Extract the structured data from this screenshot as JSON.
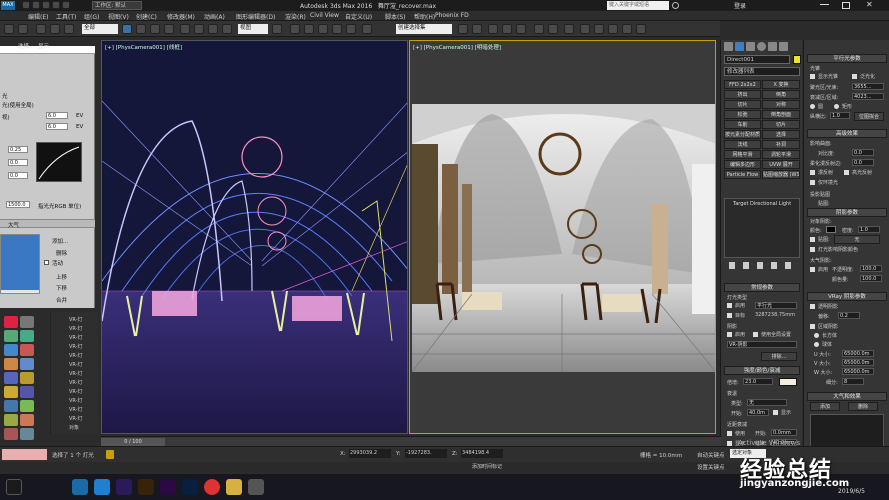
{
  "window": {
    "title": "Autodesk 3ds Max 2016",
    "file": "舞厅渲_recover.max",
    "workspace_label": "工作区: 默认",
    "search_placeholder": "键入关键字或短语",
    "login": "登录"
  },
  "menu": [
    "编辑(E)",
    "工具(T)",
    "组(G)",
    "视图(V)",
    "创建(C)",
    "修改器(M)",
    "动画(A)",
    "图形编辑器(D)",
    "渲染(R)",
    "Civil View",
    "自定义(U)",
    "脚本(S)",
    "帮助(H)",
    "Phoenix FD"
  ],
  "toolbar": {
    "selection_filter": "全部",
    "view_dropdown": "视图",
    "named_selection": "创建选择集"
  },
  "left_panel": {
    "tabs": [
      "选择",
      "显示"
    ],
    "rows": [
      "光",
      "光(使用全局)",
      "视)",
      "EV",
      "EV",
      "指光光RGB 单位)"
    ],
    "values": [
      "6.0",
      "6.0",
      "0.25",
      "0.0",
      "0.0",
      "1500.0"
    ],
    "section_atmos": "大气",
    "btn_add": "添加...",
    "btn_delete": "删除",
    "btn_active": "活动",
    "btn_up": "上移",
    "btn_down": "下移",
    "btn_merge": "合并"
  },
  "scene_list": {
    "items": [
      "VR-灯",
      "VR-灯",
      "VR-灯",
      "VR-灯",
      "VR-灯",
      "VR-灯",
      "VR-灯",
      "VR-灯",
      "VR-灯",
      "VR-灯",
      "VR-灯",
      "VR-灯",
      "对象"
    ]
  },
  "viewports": {
    "left_label": "[+] [PhysCamera001] [线框]",
    "right_label": "[+] [PhysCamera001] [明暗处理]"
  },
  "right_panel": {
    "object_name": "Direct001",
    "modifier_list": "修改器列表",
    "buttons": [
      "FFD 2x2x2",
      "X 变换",
      "挤出",
      "倒角",
      "切片",
      "对称",
      "松弛",
      "倒角剖面",
      "车削",
      "切片",
      "按元素分配材质",
      "选择",
      "法线",
      "补洞",
      "网格平滑",
      "涡轮平滑",
      "编辑多边形",
      "UVW 展开",
      "Particle Flow",
      "贴图缩放器 (WSM)"
    ],
    "target_light": "Target Directional Light",
    "section_common": "常规参数",
    "light_type": "灯光类型",
    "enabled": "启用",
    "light_kind": "平行光",
    "target": "目标",
    "target_value": "3287238.75mm",
    "shadow": "阴影",
    "shadow_enable": "启用",
    "use_global": "使用全局设置",
    "shadow_type": "VR-阴影",
    "exclude": "排除...",
    "section_intensity": "强度/颜色/衰减",
    "multiplier_label": "倍增:",
    "multiplier": "23.0",
    "decay": "衰退",
    "decay_type_label": "类型:",
    "decay_type": "无",
    "start_label": "开始:",
    "start": "40.0m",
    "show": "显示",
    "near_atten": "近距衰减",
    "use": "使用",
    "near_start_label": "开始:",
    "near_start": "0.0mm",
    "display": "显示",
    "near_end_label": "结束:",
    "near_end": "40.0mm"
  },
  "right_panel2": {
    "section_dir": "平行光参数",
    "light_cone": "光锥",
    "show_cone": "显示光锥",
    "overshoot": "泛光化",
    "hotspot_label": "聚光区/光束:",
    "hotspot": "3655...",
    "falloff_label": "衰减区/区域:",
    "falloff": "4023...",
    "circle": "圆",
    "rect": "矩形",
    "aspect_label": "纵横比:",
    "aspect": "1.0",
    "bitmap_fit": "位图拟合",
    "section_adv": "高级效果",
    "affect_surface": "影响曲面:",
    "contrast_label": "对比度:",
    "contrast": "0.0",
    "soften_label": "柔化漫反射边:",
    "soften": "0.0",
    "diffuse": "漫反射",
    "specular": "高光反射",
    "ambient_only": "仅环境光",
    "projector": "投影贴图",
    "map": "贴图:",
    "section_shadow": "阴影参数",
    "object_shadow": "对象阴影:",
    "color": "颜色:",
    "density_label": "密度:",
    "density": "1.0",
    "map2": "贴图:",
    "none": "无",
    "light_affects": "灯光影响阴影颜色",
    "atmos_shadow": "大气阴影:",
    "atmos_enable": "启用",
    "opacity_label": "不透明度:",
    "opacity": "100.0",
    "color_amount_label": "颜色量:",
    "color_amount": "100.0",
    "section_vray": "VRay 阴影参数",
    "transparent_shadows": "透明阴影",
    "bias_label": "偏移:",
    "bias": "0.2",
    "area_shadow": "区域阴影",
    "box": "长方体",
    "sphere": "球体",
    "u_size_label": "U 大小:",
    "u_size": "65000.0m",
    "v_size_label": "V 大小:",
    "v_size": "65000.0m",
    "w_size_label": "W 大小:",
    "w_size": "65000.0m",
    "subdivs_label": "细分:",
    "subdivs": "8",
    "section_atmos": "大气和效果",
    "add": "添加",
    "delete": "删除"
  },
  "timeline": {
    "frame": "0 / 100"
  },
  "status": {
    "selected": "选择了 1 个 灯光",
    "x_label": "X:",
    "x": "2993039.2",
    "y_label": "Y:",
    "y": "-1927283.",
    "z_label": "Z:",
    "z": "3484198.4",
    "grid": "栅格 = 10.0mm",
    "auto_key": "自动关键点",
    "set_key": "设置关键点",
    "key_filter": "关键点过滤器...",
    "selected_obj": "选定对象",
    "add_time_tag": "添加时间标记",
    "activate_windows": "Activate Windows",
    "activate_sub": "Go to Settings to activate Windows.",
    "maxscript": "欢迎使用 MAXScript。"
  },
  "taskbar": {
    "date": "2019/6/5",
    "clock": "14:52"
  },
  "watermark": {
    "cn": "经验总结",
    "url": "jingyanzongjie.com"
  }
}
